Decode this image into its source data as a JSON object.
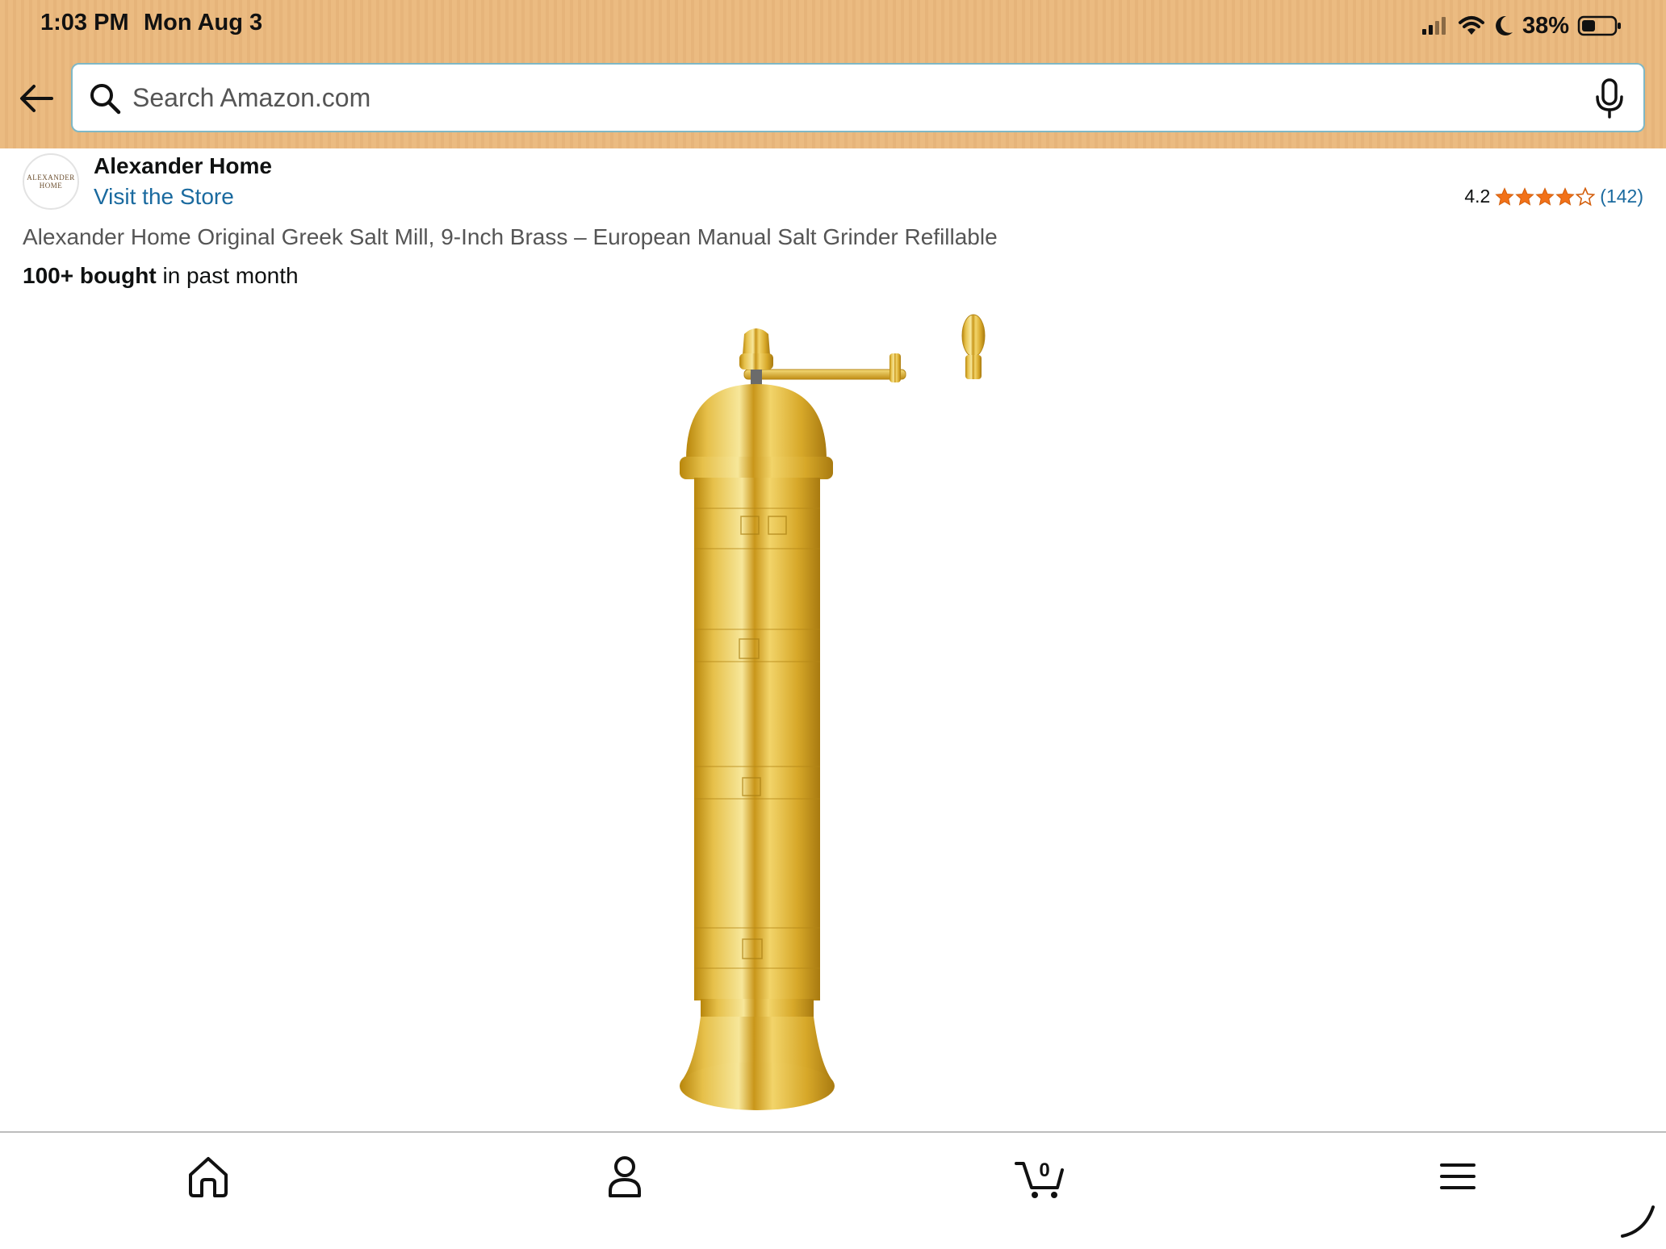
{
  "status_bar": {
    "time": "1:03 PM",
    "date": "Mon Aug 3",
    "battery": "38%",
    "icons": [
      "cellular-signal-icon",
      "wifi-icon",
      "moon-icon",
      "battery-icon"
    ]
  },
  "header": {
    "back_icon": "arrow-left-icon",
    "search": {
      "placeholder": "Search Amazon.com",
      "value": ""
    },
    "search_icon": "search-icon",
    "mic_icon": "microphone-icon"
  },
  "product": {
    "brand_logo_text": [
      "ALEXANDER",
      "HOME"
    ],
    "brand_name": "Alexander Home",
    "store_link": "Visit the Store",
    "rating": "4.2",
    "stars": 4.2,
    "rating_count": "(142)",
    "title": "Alexander Home Original Greek Salt Mill, 9-Inch Brass – European Manual Salt Grinder Refillable",
    "bought_bold": "100+ bought",
    "bought_rest": " in past month"
  },
  "bottom_nav": {
    "items": [
      {
        "name": "home",
        "icon": "home-icon"
      },
      {
        "name": "account",
        "icon": "user-icon"
      },
      {
        "name": "cart",
        "icon": "cart-icon",
        "count": "0"
      },
      {
        "name": "menu",
        "icon": "hamburger-menu-icon"
      }
    ],
    "active": "home"
  },
  "colors": {
    "header_bg": "#EBBB81",
    "link": "#1A6A9F",
    "star": "#F27118",
    "brass": "#D9A81F"
  }
}
